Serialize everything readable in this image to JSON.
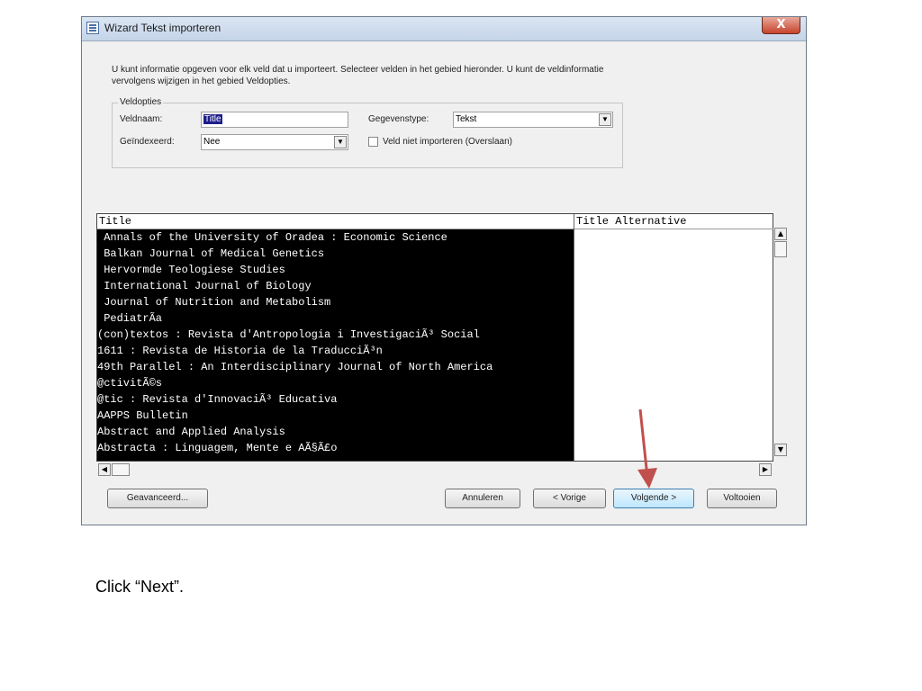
{
  "window": {
    "title": "Wizard Tekst importeren",
    "close_label": "X"
  },
  "intro": {
    "line1": "U kunt informatie opgeven voor elk veld dat u importeert. Selecteer velden in het gebied hieronder. U kunt de veldinformatie",
    "line2": "vervolgens wijzigen in het gebied Veldopties."
  },
  "field_options": {
    "legend": "Veldopties",
    "veldnaam_label": "Veldnaam:",
    "veldnaam_value": "Title",
    "gegevenstype_label": "Gegevenstype:",
    "gegevenstype_value": "Tekst",
    "geindexeerd_label": "Geïndexeerd:",
    "geindexeerd_value": "Nee",
    "skip_label": "Veld niet importeren (Overslaan)"
  },
  "grid": {
    "columns": [
      "Title",
      "Title Alternative"
    ],
    "rows": [
      " Annals of the University of Oradea : Economic Science",
      " Balkan Journal of Medical Genetics",
      " Hervormde Teologiese Studies",
      " International Journal of Biology",
      " Journal of Nutrition and Metabolism",
      " PediatrÃ­a",
      "(con)textos : Revista d'Antropologia i InvestigaciÃ³ Social",
      "1611 : Revista de Historia de la TraducciÃ³n",
      "49th Parallel : An Interdisciplinary Journal of North America",
      "@ctivitÃ©s",
      "@tic : Revista d'InnovaciÃ³ Educativa",
      "AAPPS Bulletin",
      "Abstract and Applied Analysis",
      "Abstracta : Linguagem, Mente e AÃ§Ã£o"
    ]
  },
  "buttons": {
    "advanced": "Geavanceerd...",
    "cancel": "Annuleren",
    "previous": "< Vorige",
    "next": "Volgende >",
    "finish": "Voltooien"
  },
  "caption": "Click “Next”.",
  "colors": {
    "arrow": "#c0504d",
    "grid_bg": "#000000"
  }
}
